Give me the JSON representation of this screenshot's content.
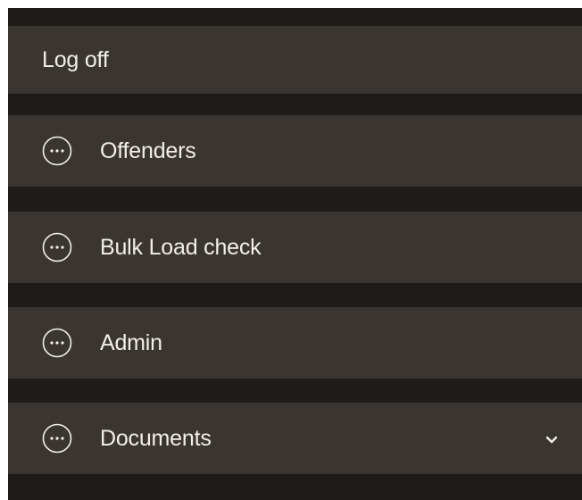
{
  "menu": {
    "logoff": {
      "label": "Log off"
    },
    "items": [
      {
        "label": "Offenders",
        "icon": "more-options-icon"
      },
      {
        "label": "Bulk Load check",
        "icon": "more-options-icon"
      },
      {
        "label": "Admin",
        "icon": "more-options-icon"
      },
      {
        "label": "Documents",
        "icon": "more-options-icon",
        "has_chevron": true,
        "chevron_icon": "chevron-down-icon"
      }
    ]
  },
  "colors": {
    "menu_background": "#1e1b18",
    "item_background": "#3a3531",
    "text": "#f2efea"
  }
}
